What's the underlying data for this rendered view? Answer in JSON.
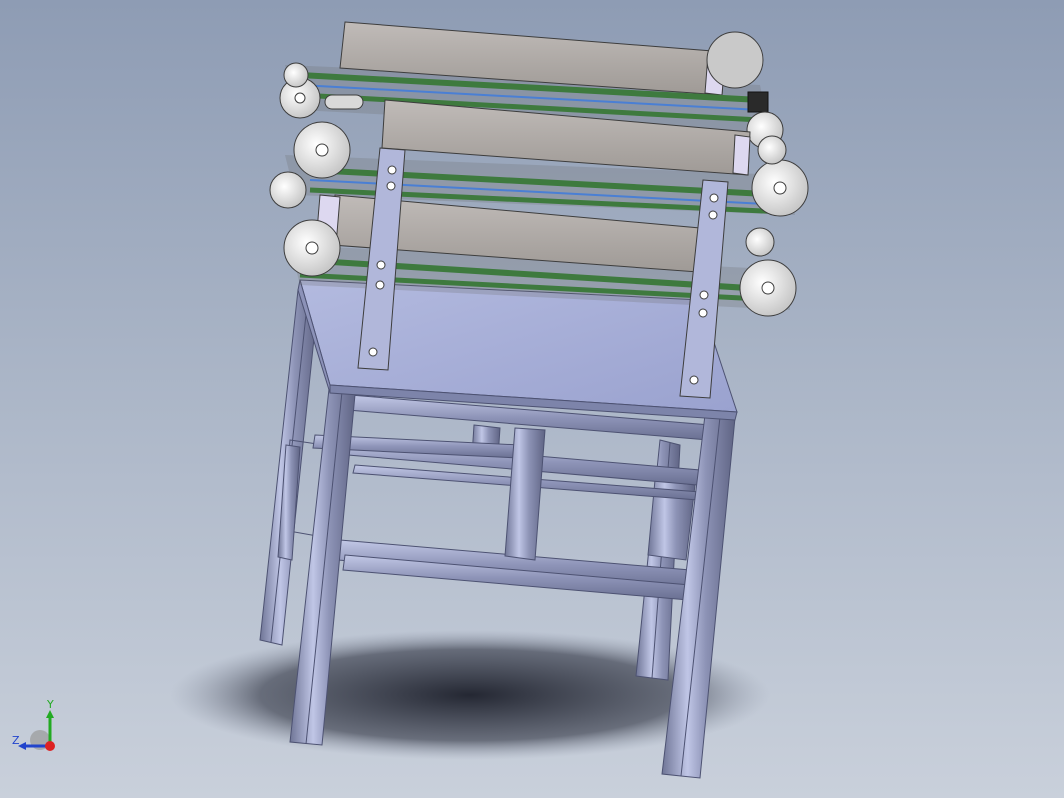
{
  "viewport": {
    "background_top": "#8e9cb4",
    "background_bottom": "#c9d0db"
  },
  "colors": {
    "frame_profile": "#9ea5c6",
    "frame_shadow": "#5b6080",
    "table_top": "#a6aedb",
    "conveyor_body": "#b0aaa6",
    "belt_green": "#3e7a3e",
    "pulley_white": "#e8e8e8",
    "bracket": "#a8aed0",
    "belt_blue": "#4a7fd4"
  },
  "triad": {
    "y_label": "Y",
    "z_label": "Z",
    "y_color": "#22aa22",
    "z_color": "#2244cc",
    "x_color": "#dd2222"
  }
}
